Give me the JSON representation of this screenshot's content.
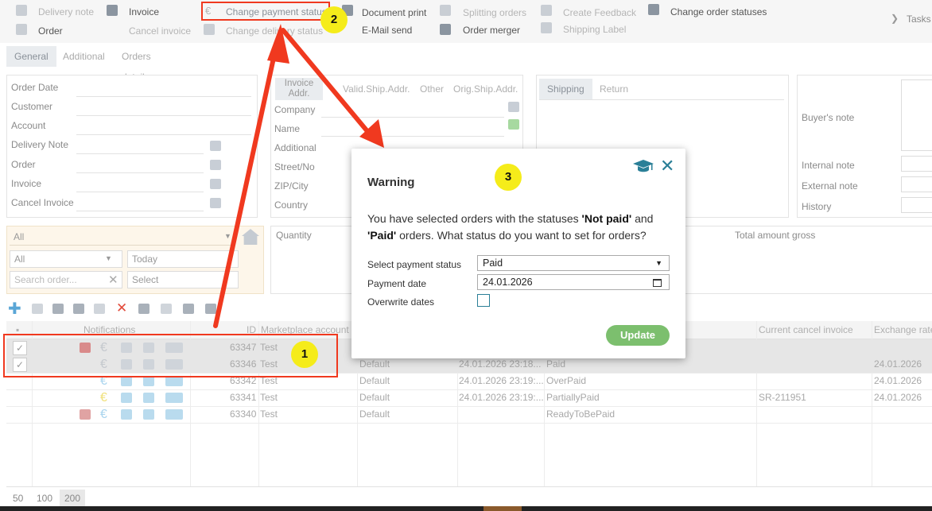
{
  "toolbar": {
    "delivery_note": "Delivery note",
    "invoice": "Invoice",
    "change_payment_status": "Change payment status",
    "document_print": "Document print",
    "splitting_orders": "Splitting orders",
    "create_feedback": "Create Feedback",
    "change_order_statuses": "Change order statuses",
    "tasks": "Tasks",
    "order": "Order",
    "cancel_invoice": "Cancel invoice",
    "change_delivery_status": "Change delivery status",
    "email_send": "E-Mail send",
    "order_merger": "Order merger",
    "shipping_label": "Shipping Label"
  },
  "tabs": [
    "General",
    "Additional",
    "Orders detail"
  ],
  "general_form": {
    "labels": [
      "Order Date",
      "Customer",
      "Account",
      "Delivery Note",
      "Order",
      "Invoice",
      "Cancel Invoice"
    ]
  },
  "address_tabs": [
    "Invoice Addr.",
    "Valid.Ship.Addr.",
    "Other",
    "Orig.Ship.Addr."
  ],
  "address_labels": [
    "Company",
    "Name",
    "Additional",
    "Street/No",
    "ZIP/City",
    "Country"
  ],
  "shipping_tabs": [
    "Shipping",
    "Return"
  ],
  "notes_labels": {
    "buyers_note": "Buyer's note",
    "internal_note": "Internal note",
    "external_note": "External note",
    "history": "History"
  },
  "filters": {
    "all_top": "All",
    "all": "All",
    "today": "Today",
    "search_placeholder": "Search order...",
    "select": "Select"
  },
  "summary": {
    "quantity": "Quantity",
    "total_amount_gross": "Total amount gross"
  },
  "grid": {
    "headers": {
      "notifications": "Notifications",
      "id": "ID",
      "marketplace_account": "Marketplace account",
      "current_cancel_invoice": "Current cancel invoice",
      "exchange_rate": "Exchange rate"
    },
    "rows": [
      {
        "id": "63347",
        "account": "Test",
        "shop": "",
        "date": "",
        "status": "",
        "cancel": "",
        "rate": "",
        "selected": true
      },
      {
        "id": "63346",
        "account": "Test",
        "shop": "Default",
        "date": "24.01.2026 23:18...",
        "status": "Paid",
        "cancel": "",
        "rate": "24.01.2026",
        "selected": true
      },
      {
        "id": "63342",
        "account": "Test",
        "shop": "Default",
        "date": "24.01.2026 23:19:...",
        "status": "OverPaid",
        "cancel": "",
        "rate": "24.01.2026",
        "selected": false
      },
      {
        "id": "63341",
        "account": "Test",
        "shop": "Default",
        "date": "24.01.2026 23:19:...",
        "status": "PartiallyPaid",
        "cancel": "SR-211951",
        "rate": "24.01.2026",
        "selected": false
      },
      {
        "id": "63340",
        "account": "Test",
        "shop": "Default",
        "date": "",
        "status": "ReadyToBePaid",
        "cancel": "",
        "rate": "",
        "selected": false
      }
    ]
  },
  "pager": [
    "50",
    "100",
    "200"
  ],
  "dialog": {
    "title": "Warning",
    "msg_pre": "You have selected orders with the statuses ",
    "status1": "'Not paid'",
    "msg_and": " and ",
    "status2": "'Paid'",
    "msg_post": " orders. What status do you want to set for orders?",
    "label_payment_status": "Select payment status",
    "payment_status_value": "Paid",
    "label_payment_date": "Payment date",
    "payment_date_value": "24.01.2026",
    "label_overwrite": "Overwrite dates",
    "update_label": "Update"
  },
  "badges": [
    "1",
    "2",
    "3"
  ],
  "colors": {
    "highlight_red": "#f0391f",
    "badge_yellow": "#f5ec1a",
    "update_green": "#7cbf6e",
    "teal": "#2a7f97"
  }
}
